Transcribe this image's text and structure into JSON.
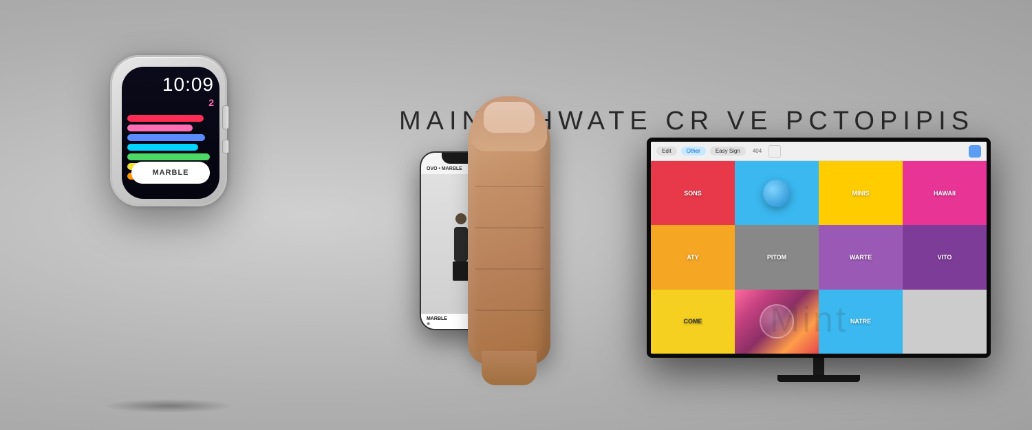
{
  "background": {
    "color_from": "#c8c8c8",
    "color_to": "#b0b0b0"
  },
  "heading": {
    "text": "MAINARHWATE Cr Ve PCTOPIPIS"
  },
  "watch": {
    "time": "10:09",
    "date": "2",
    "button_label": "MARBLE",
    "bars": [
      "red",
      "pink",
      "blue",
      "cyan",
      "green",
      "yellow",
      "orange"
    ]
  },
  "phone": {
    "header_text": "OVO • MARBLE",
    "artist": "Figure standing"
  },
  "finger": {
    "description": "Human thumb pointing up"
  },
  "tv": {
    "tabs": [
      "Edit",
      "Other",
      "Easy Sign"
    ],
    "active_tab": "Other",
    "icon_label": "404",
    "cells": [
      {
        "label": "SONS",
        "color": "#e8394a"
      },
      {
        "label": "",
        "color": "#3bb8f0",
        "has_icon": true
      },
      {
        "label": "MINIS",
        "color": "#ffcc00"
      },
      {
        "label": "HAWAII",
        "color": "#e83494"
      },
      {
        "label": "ATY",
        "color": "#f5a623"
      },
      {
        "label": "PITOM",
        "color": "#888888"
      },
      {
        "label": "WARTE",
        "color": "#9b59b6"
      },
      {
        "label": "VITO",
        "color": "#9b59b6"
      },
      {
        "label": "COME",
        "color": "#f5d020"
      },
      {
        "label": "",
        "color": "#e8394a",
        "has_image": true
      },
      {
        "label": "NATRE",
        "color": "#3bb8f0"
      },
      {
        "label": "",
        "color": "#cccccc"
      }
    ]
  },
  "mint_text": "Mint"
}
